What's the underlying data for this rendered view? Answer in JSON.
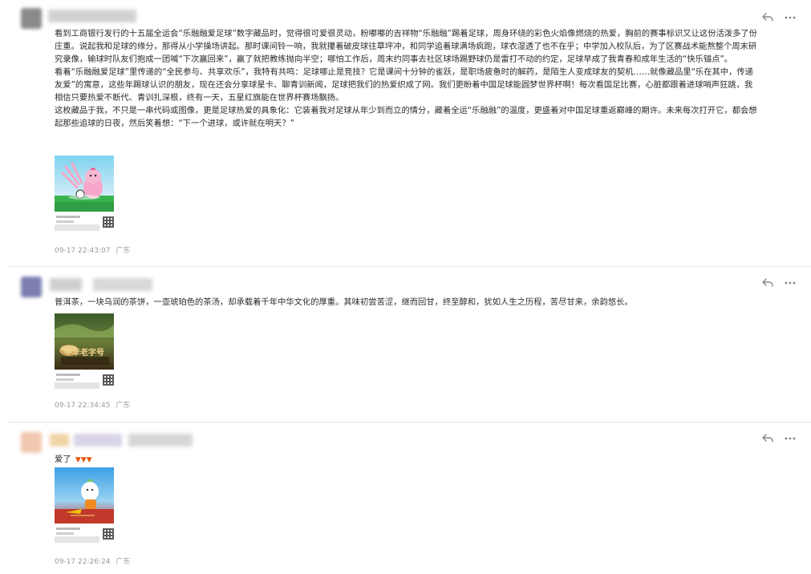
{
  "posts": [
    {
      "paragraphs": [
        "看到工商银行发行的十五届全运会“乐融融爱足球”数字藏品时，觉得很可爱很灵动，粉嘟嘟的吉祥物“乐融融”踢着足球，周身环绕的彩色火焰像燃烧的热爱，胸前的赛事标识又让这份活泼多了份庄重。说起我和足球的缘分，那得从小学操场讲起。那时课间铃一响，我就攥着破皮球往草坪冲，和同学追着球满场疯跑，球衣湿透了也不在乎；中学加入校队后，为了区赛战术能熬整个周末研究录像，输球时队友们抱成一团喊“下次赢回来”，赢了就把教练抛向半空；哪怕工作后，周末约同事去社区球场踢野球仍是雷打不动的约定，足球早成了我青春和成年生活的“快乐锚点”。",
        "看着“乐融融爱足球”里传递的“全民参与、共享欢乐”，我特有共鸣：足球哪止是竞技？它是课间十分钟的雀跃，是职场疲惫时的解药，是陌生人变成球友的契机……就像藏品里“乐在其中，传递友爱”的寓意，这些年踢球认识的朋友，现在还会分享球星卡、聊青训新闻，足球把我们的热爱织成了网。我们更盼着中国足球能圆梦世界杯啊！每次看国足比赛，心脏都跟着进球哨声狂跳，我相信只要热爱不断代、青训扎深根，终有一天，五星红旗能在世界杯赛场飘扬。",
        "这枚藏品于我，不只是一串代码或图像，更是足球热爱的具象化：它装着我对足球从年少到而立的情分，藏着全运“乐融融”的温度，更盛着对中国足球重返巅峰的期许。未来每次打开它，都会想起那些追球的日夜，然后笑着想：“下一个进球，或许就在明天？”"
      ],
      "timestamp": "09-17 22:43:07",
      "region": "广东"
    },
    {
      "paragraphs": [
        "普洱茶，一块乌润的茶饼，一壶琥珀色的茶汤，却承载着千年中华文化的厚重。其味初尝苦涩，继而回甘，终至醇和，犹如人生之历程，苦尽甘来，余韵悠长。"
      ],
      "card_caption": "中华老字号",
      "timestamp": "09-17 22:34:45",
      "region": "广东"
    },
    {
      "paragraphs": [
        "爱了"
      ],
      "timestamp": "09-17 22:26:24",
      "region": "广东"
    }
  ],
  "icons": {
    "reply": "reply-icon",
    "more": "more-icon"
  }
}
